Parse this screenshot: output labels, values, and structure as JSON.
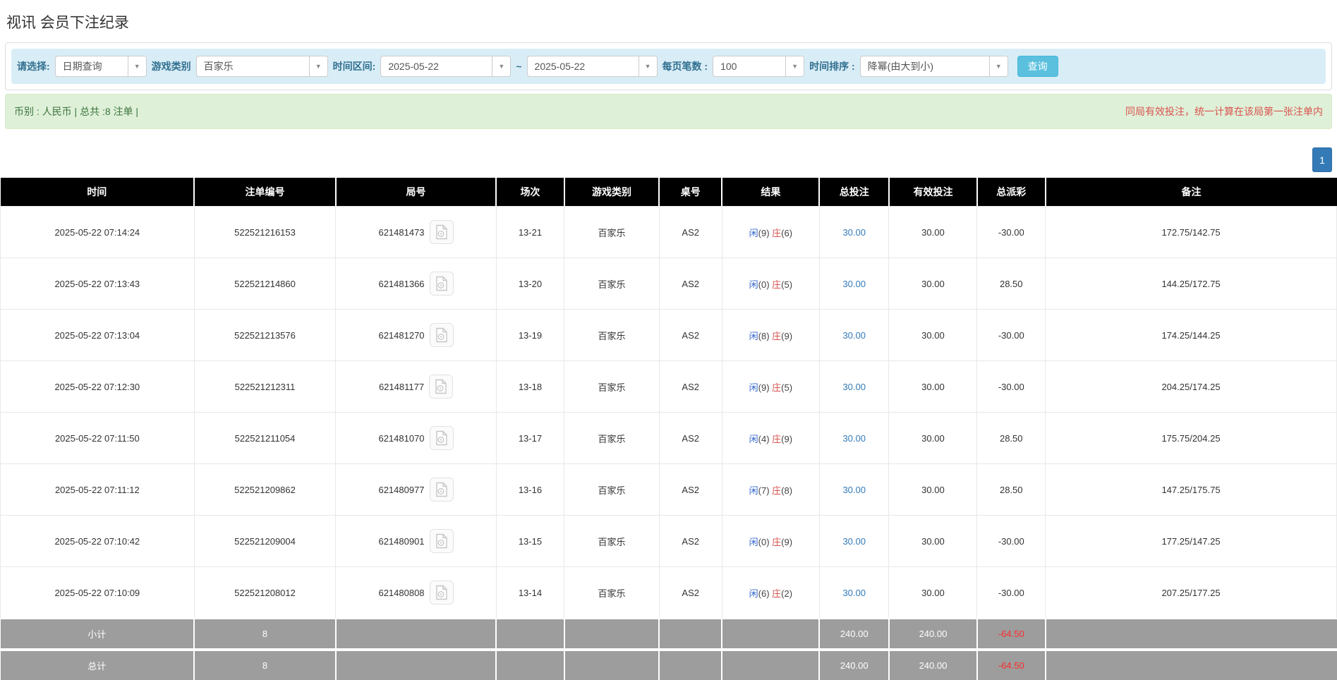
{
  "page": {
    "title": "视讯 会员下注纪录"
  },
  "filters": {
    "select_label": "请选择:",
    "select_value": "日期查询",
    "game_label": "游戏类别",
    "game_value": "百家乐",
    "range_label": "时间区间:",
    "date_from": "2025-05-22",
    "tilde": "~",
    "date_to": "2025-05-22",
    "per_page_label": "每页笔数 :",
    "per_page_value": "100",
    "sort_label": "时间排序 :",
    "sort_value": "降幂(由大到小)",
    "search_button": "查询",
    "caret_icon": "▼"
  },
  "summary_bar": {
    "left": "币别 : 人民币 | 总共 :8 注单 |",
    "right": "同局有效投注，统一计算在该局第一张注单内"
  },
  "pagination": {
    "page": "1"
  },
  "table": {
    "headers": [
      "时间",
      "注单编号",
      "局号",
      "场次",
      "游戏类别",
      "桌号",
      "结果",
      "总投注",
      "有效投注",
      "总派彩",
      "备注"
    ],
    "rows": [
      {
        "time": "2025-05-22 07:14:24",
        "bet_id": "522521216153",
        "round_id": "621481473",
        "session": "13-21",
        "game": "百家乐",
        "table_no": "AS2",
        "player": "闲",
        "player_score": "(9)",
        "banker": "庄",
        "banker_score": "(6)",
        "total_bet": "30.00",
        "valid_bet": "30.00",
        "payout": "-30.00",
        "note": "172.75/142.75"
      },
      {
        "time": "2025-05-22 07:13:43",
        "bet_id": "522521214860",
        "round_id": "621481366",
        "session": "13-20",
        "game": "百家乐",
        "table_no": "AS2",
        "player": "闲",
        "player_score": "(0)",
        "banker": "庄",
        "banker_score": "(5)",
        "total_bet": "30.00",
        "valid_bet": "30.00",
        "payout": "28.50",
        "note": "144.25/172.75"
      },
      {
        "time": "2025-05-22 07:13:04",
        "bet_id": "522521213576",
        "round_id": "621481270",
        "session": "13-19",
        "game": "百家乐",
        "table_no": "AS2",
        "player": "闲",
        "player_score": "(8)",
        "banker": "庄",
        "banker_score": "(9)",
        "total_bet": "30.00",
        "valid_bet": "30.00",
        "payout": "-30.00",
        "note": "174.25/144.25"
      },
      {
        "time": "2025-05-22 07:12:30",
        "bet_id": "522521212311",
        "round_id": "621481177",
        "session": "13-18",
        "game": "百家乐",
        "table_no": "AS2",
        "player": "闲",
        "player_score": "(9)",
        "banker": "庄",
        "banker_score": "(5)",
        "total_bet": "30.00",
        "valid_bet": "30.00",
        "payout": "-30.00",
        "note": "204.25/174.25"
      },
      {
        "time": "2025-05-22 07:11:50",
        "bet_id": "522521211054",
        "round_id": "621481070",
        "session": "13-17",
        "game": "百家乐",
        "table_no": "AS2",
        "player": "闲",
        "player_score": "(4)",
        "banker": "庄",
        "banker_score": "(9)",
        "total_bet": "30.00",
        "valid_bet": "30.00",
        "payout": "28.50",
        "note": "175.75/204.25"
      },
      {
        "time": "2025-05-22 07:11:12",
        "bet_id": "522521209862",
        "round_id": "621480977",
        "session": "13-16",
        "game": "百家乐",
        "table_no": "AS2",
        "player": "闲",
        "player_score": "(7)",
        "banker": "庄",
        "banker_score": "(8)",
        "total_bet": "30.00",
        "valid_bet": "30.00",
        "payout": "28.50",
        "note": "147.25/175.75"
      },
      {
        "time": "2025-05-22 07:10:42",
        "bet_id": "522521209004",
        "round_id": "621480901",
        "session": "13-15",
        "game": "百家乐",
        "table_no": "AS2",
        "player": "闲",
        "player_score": "(0)",
        "banker": "庄",
        "banker_score": "(9)",
        "total_bet": "30.00",
        "valid_bet": "30.00",
        "payout": "-30.00",
        "note": "177.25/147.25"
      },
      {
        "time": "2025-05-22 07:10:09",
        "bet_id": "522521208012",
        "round_id": "621480808",
        "session": "13-14",
        "game": "百家乐",
        "table_no": "AS2",
        "player": "闲",
        "player_score": "(6)",
        "banker": "庄",
        "banker_score": "(2)",
        "total_bet": "30.00",
        "valid_bet": "30.00",
        "payout": "-30.00",
        "note": "207.25/177.25"
      }
    ],
    "subtotal": {
      "label": "小计",
      "count": "8",
      "total_bet": "240.00",
      "valid_bet": "240.00",
      "payout": "-64.50"
    },
    "total": {
      "label": "总计",
      "count": "8",
      "total_bet": "240.00",
      "valid_bet": "240.00",
      "payout": "-64.50"
    }
  },
  "colors": {
    "filter_bg": "#d9edf7",
    "filter_label": "#31708f",
    "search_button_bg": "#5bc0de",
    "alert_bg": "#dff0d8",
    "alert_text": "#3c763d",
    "notice_red": "#d9534f",
    "link_blue": "#337ab7",
    "player_blue": "#3366cc",
    "banker_red": "#d9534f",
    "negative_red": "#e60000",
    "table_header_bg": "#000000",
    "summary_row_bg": "#9d9d9d",
    "pagination_bg": "#337ab7"
  }
}
